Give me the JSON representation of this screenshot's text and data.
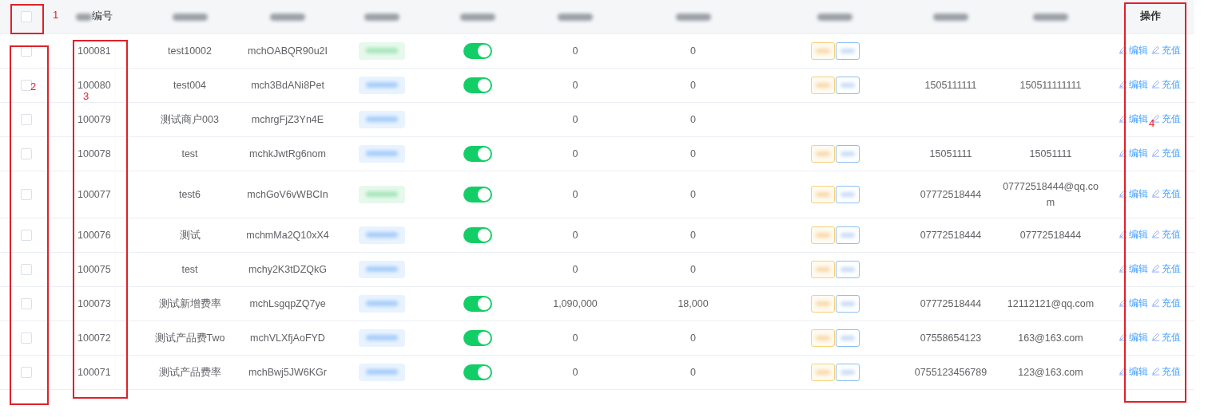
{
  "table": {
    "columns": [
      {
        "kind": "select"
      },
      {
        "kind": "partly_blurred",
        "label": "编号"
      },
      {
        "kind": "blurred"
      },
      {
        "kind": "blurred"
      },
      {
        "kind": "blurred"
      },
      {
        "kind": "blurred"
      },
      {
        "kind": "blurred"
      },
      {
        "kind": "blurred"
      },
      {
        "kind": "blurred"
      },
      {
        "kind": "blurred"
      },
      {
        "kind": "blurred"
      },
      {
        "kind": "text",
        "label": "操作"
      }
    ],
    "select_all": {
      "checked": false
    },
    "rows": [
      {
        "checked": false,
        "id": "100081",
        "name": "test10002",
        "mch": "mchOABQR90u2I",
        "color": "#e7f8ec",
        "switch_on": true,
        "amount": "0",
        "amount_2": "0",
        "product_tags": true,
        "contact": "",
        "email": "",
        "actions": [
          "编辑",
          "充值"
        ]
      },
      {
        "checked": false,
        "id": "100080",
        "name": "test004",
        "mch": "mch3BdANi8Pet",
        "color": "#e8f3ff",
        "switch_on": true,
        "amount": "0",
        "amount_2": "0",
        "product_tags": true,
        "contact": "1505111111",
        "email": "150511111111",
        "actions": [
          "编辑",
          "充值"
        ]
      },
      {
        "checked": false,
        "id": "100079",
        "name": "测试商户003",
        "mch": "mchrgFjZ3Yn4E",
        "color": "#e8f3ff",
        "amount": "0",
        "amount_2": "0",
        "product_tags": false,
        "contact": "",
        "email": "",
        "actions": [
          "编辑",
          "充值"
        ]
      },
      {
        "checked": false,
        "id": "100078",
        "name": "test",
        "mch": "mchkJwtRg6nom",
        "color": "#e8f3ff",
        "switch_on": true,
        "amount": "0",
        "amount_2": "0",
        "product_tags": true,
        "contact": "15051111",
        "email": "15051111",
        "actions": [
          "编辑",
          "充值"
        ]
      },
      {
        "checked": false,
        "id": "100077",
        "name": "test6",
        "mch": "mchGoV6vWBCIn",
        "color": "#e7f8ec",
        "switch_on": true,
        "amount": "0",
        "amount_2": "0",
        "product_tags": true,
        "contact": "07772518444",
        "email": "07772518444@qq.com",
        "actions": [
          "编辑",
          "充值"
        ]
      },
      {
        "checked": false,
        "id": "100076",
        "name": "测试",
        "mch": "mchmMa2Q10xX4",
        "color": "#e8f3ff",
        "switch_on": true,
        "amount": "0",
        "amount_2": "0",
        "product_tags": true,
        "contact": "07772518444",
        "email": "07772518444",
        "actions": [
          "编辑",
          "充值"
        ]
      },
      {
        "checked": false,
        "id": "100075",
        "name": "test",
        "mch": "mchy2K3tDZQkG",
        "color": "#e8f3ff",
        "amount": "0",
        "amount_2": "0",
        "product_tags": true,
        "contact": "",
        "email": "",
        "actions": [
          "编辑",
          "充值"
        ]
      },
      {
        "checked": false,
        "id": "100073",
        "name": "测试新增费率",
        "mch": "mchLsgqpZQ7ye",
        "color": "#e8f3ff",
        "switch_on": true,
        "amount": "1,090,000",
        "amount_2": "18,000",
        "product_tags": true,
        "contact": "07772518444",
        "email": "12112121@qq.com",
        "actions": [
          "编辑",
          "充值"
        ]
      },
      {
        "checked": false,
        "id": "100072",
        "name": "测试产品费Two",
        "mch": "mchVLXfjAoFYD",
        "color": "#e8f3ff",
        "switch_on": true,
        "amount": "0",
        "amount_2": "0",
        "product_tags": true,
        "contact": "07558654123",
        "email": "163@163.com",
        "actions": [
          "编辑",
          "充值"
        ]
      },
      {
        "checked": false,
        "id": "100071",
        "name": "测试产品费率",
        "mch": "mchBwj5JW6KGr",
        "color": "#e8f3ff",
        "switch_on": true,
        "amount": "0",
        "amount_2": "0",
        "product_tags": true,
        "contact": "0755123456789",
        "email": "123@163.com",
        "actions": [
          "编辑",
          "充值"
        ]
      }
    ]
  },
  "annotations": [
    {
      "label": "1"
    },
    {
      "label": "2"
    },
    {
      "label": "3"
    },
    {
      "label": "4"
    }
  ]
}
